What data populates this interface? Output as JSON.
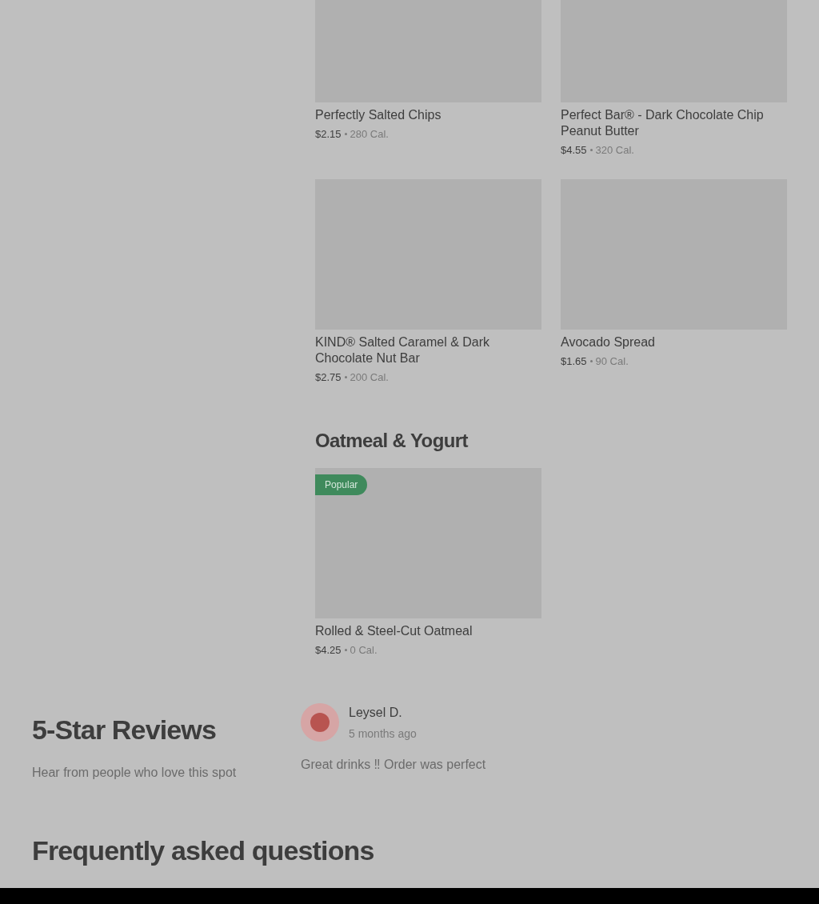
{
  "menu_sections": [
    {
      "items": [
        {
          "name": "Perfectly Salted Chips",
          "price": "$2.15",
          "calories": "280 Cal."
        },
        {
          "name": "Perfect Bar® - Dark Chocolate Chip Peanut Butter",
          "price": "$4.55",
          "calories": "320 Cal."
        },
        {
          "name": "KIND® Salted Caramel & Dark Chocolate Nut Bar",
          "price": "$2.75",
          "calories": "200 Cal."
        },
        {
          "name": "Avocado Spread",
          "price": "$1.65",
          "calories": "90 Cal."
        }
      ]
    },
    {
      "title": "Oatmeal & Yogurt",
      "items": [
        {
          "name": "Rolled & Steel-Cut Oatmeal",
          "price": "$4.25",
          "calories": "0 Cal.",
          "badge": "Popular"
        }
      ]
    }
  ],
  "reviews": {
    "title": "5-Star Reviews",
    "subtitle": "Hear from people who love this spot",
    "items": [
      {
        "author": "Leysel D.",
        "time": "5 months ago",
        "text": "Great drinks ‼ Order was perfect"
      }
    ]
  },
  "faq": {
    "title": "Frequently asked questions"
  }
}
